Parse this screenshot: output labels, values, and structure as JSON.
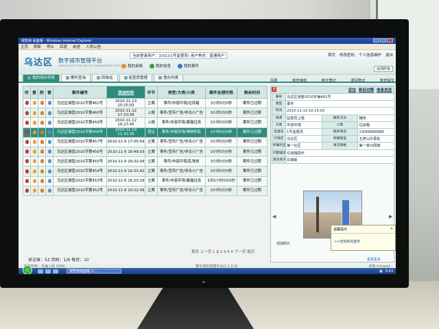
{
  "browser": {
    "title": "城管通 桌面版 - Windows Internet Explorer",
    "menu": [
      "主页",
      "刷新",
      "停止",
      "后退",
      "前进",
      "人员公告"
    ]
  },
  "header": {
    "logo": "乌达区",
    "subtitle": "数字城市管理平台",
    "subtitle_en": "WUDA DISTRICT DIGITAL CITY MANAGEMENT PLATFORM",
    "user_info": "当前登录用户：1(01)(1号监督员) 用户角色：普通用户",
    "quick_links": [
      "我的桌面",
      "我的信息",
      "我的事件"
    ],
    "top_right_links": [
      "首页",
      "修改密码",
      "个人信息维护",
      "退出"
    ],
    "close_all": "关闭所有"
  },
  "tabs": [
    {
      "label": "我的待办列表",
      "active": true
    },
    {
      "label": "案件查询",
      "active": false
    },
    {
      "label": "回收站",
      "active": false
    },
    {
      "label": "巡查员管理",
      "active": false
    },
    {
      "label": "督办列表",
      "active": false
    }
  ],
  "table": {
    "headers": {
      "flags": [
        "时",
        "督",
        "附",
        "督"
      ],
      "case_no": "案件编号",
      "time": "添加时间",
      "stage": "环节",
      "category": "类型/大类/小类",
      "deadline": "案件处理时限",
      "remaining": "剩余时间"
    },
    "rows": [
      {
        "case_no": "乌达区城管2010字第461号",
        "time": "2010-11-13 10:15:03",
        "stage": "立案",
        "category": "事件/市容环境/垃圾箱",
        "deadline": "3小时0分0秒",
        "remaining": "案件已过期",
        "selected": false
      },
      {
        "case_no": "乌达区城管2010字第460号",
        "time": "2010-11-12 17:10:58",
        "stage": "上报",
        "category": "事件/宣传广告/非法小广告",
        "deadline": "3小时0分0秒",
        "remaining": "案件已过期",
        "selected": false
      },
      {
        "case_no": "乌达区城管2010字第459号",
        "time": "2010-11-12 16:27:45",
        "stage": "上报",
        "category": "事件/市容环境/暴露垃圾",
        "deadline": "3小时0分0秒",
        "remaining": "案件已过期",
        "selected": false
      },
      {
        "case_no": "乌达区城管2010字第458号",
        "time": "2010-11-10 11:33:30",
        "stage": "签证",
        "category": "事件/市容环境/堆物积乱",
        "deadline": "3小时0分0秒",
        "remaining": "案件已过期",
        "selected": true
      },
      {
        "case_no": "乌达区城管2010字第457号",
        "time": "2010-11-9 17:05:59",
        "stage": "立案",
        "category": "事件/宣传广告/非法小广告",
        "deadline": "3小时0分0秒",
        "remaining": "案件已过期",
        "selected": false
      },
      {
        "case_no": "乌达区城管2010字第456号",
        "time": "2010-11-9 16:49:03",
        "stage": "立案",
        "category": "事件/宣传广告/非法小广告",
        "deadline": "3小时0分0秒",
        "remaining": "案件已过期",
        "selected": false
      },
      {
        "case_no": "乌达区城管2010字第455号",
        "time": "2010-11-9 16:32:09",
        "stage": "立案",
        "category": "事件/市容环境/乱堆放",
        "deadline": "3小时0分0秒",
        "remaining": "案件已过期",
        "selected": false
      },
      {
        "case_no": "乌达区城管2010字第454号",
        "time": "2010-11-9 16:31:42",
        "stage": "立案",
        "category": "事件/宣传广告/非法小广告",
        "deadline": "3小时0分0秒",
        "remaining": "案件已过期",
        "selected": false
      },
      {
        "case_no": "乌达区城管2010字第453号",
        "time": "2010-11-9 16:23:29",
        "stage": "立案",
        "category": "事件/市容环境/暴露垃圾",
        "deadline": "3天0小时0分0秒",
        "remaining": "案件已过期",
        "selected": false
      },
      {
        "case_no": "乌达区城管2010字第452号",
        "time": "2010-11-9 10:22:09",
        "stage": "立案",
        "category": "事件/宣传广告/非法小广告",
        "deadline": "3小时0分0秒",
        "remaining": "案件已过期",
        "selected": false
      }
    ]
  },
  "pager": {
    "prefix": "首页 上一页 1",
    "current": "2",
    "suffix": "3 4 5 6 下一页 尾页"
  },
  "total": "总记录：52 页码：1/6 每页：10",
  "detail": {
    "toolbar": [
      "回退",
      "核查审核",
      "移交登记",
      "退回登记",
      "核查提交"
    ],
    "tabs": [
      "定位",
      "新旧对照",
      "信息发送"
    ],
    "badge": "详",
    "rows": [
      {
        "k": "编号",
        "v": "乌达区城管2010字第461号"
      },
      {
        "k": "类型",
        "v": "事件"
      },
      {
        "k": "时间",
        "v": "2010-11-13 10:15:03"
      },
      {
        "k": "来源",
        "v": "监督员上报",
        "k2": "联系方式",
        "v2": "魏伟"
      },
      {
        "k": "大类",
        "v": "市容环境",
        "k2": "小类",
        "v2": "垃圾箱"
      },
      {
        "k": "监督员",
        "v": "1号监督员",
        "k2": "联系电话",
        "v2": "13066668888"
      },
      {
        "k": "行政区",
        "v": "乌达区",
        "k2": "所属街道",
        "v2": "五虎山办事处"
      },
      {
        "k": "所属社区",
        "v": "第一社区",
        "k2": "单元网格",
        "v2": "第一单元网格"
      },
      {
        "k": "问题描述",
        "v": "垃圾箱损坏"
      },
      {
        "k": "发生地点",
        "v": "先锋街"
      }
    ],
    "photo_caption": "现场照片",
    "more": "查看更多"
  },
  "notification": {
    "title": "温馨提示",
    "body": ">>您有新的案件"
  },
  "status_bar": {
    "left": "版权所有：乌海人民 2009",
    "mid": "数字城市管理平台(1.1.0.0)",
    "right": "本地 Intranet"
  },
  "taskbar": {
    "task": "城管通桌面版-人...",
    "clock": "9:43"
  },
  "colors": {
    "accent": "#2d8c7e",
    "header_bg": "#d2e6e2",
    "alert": "#c0392b"
  }
}
